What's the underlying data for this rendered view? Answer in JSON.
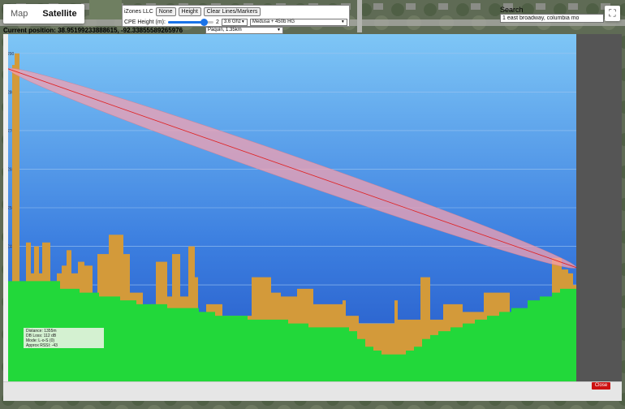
{
  "map_toggle": {
    "map": "Map",
    "satellite": "Satellite"
  },
  "controls": {
    "org": "iZones LLC",
    "none": "None",
    "height": "Height",
    "clear": "Clear Lines/Markers",
    "cpe_label": "CPE Height (m):",
    "cpe_value": "2",
    "cpe_fraction": 0.8,
    "frequency": "3.6 Ghz",
    "antenna": "Medusa + 450b HG"
  },
  "search": {
    "label": "Search",
    "value": "1 east broadway, columbia mo"
  },
  "position": "Current position: 38.95199233888615, -92.33855589265976",
  "link_select": "Paquin, 1.35km",
  "info": {
    "distance": "Distance: 1355m",
    "db_loss": "DB Loss: 112 dB",
    "mode": "Mode: L-o-S (0)",
    "rssi": "Approx RSSI: -43"
  },
  "close": "Close",
  "chart_data": {
    "type": "area",
    "ylim": [
      205,
      295
    ],
    "y_ticks": [
      210,
      220,
      230,
      240,
      250,
      260,
      270,
      280,
      290
    ],
    "x_max": 700,
    "link": {
      "start": 286,
      "end": 234.5
    },
    "terrain": [
      [
        0,
        231
      ],
      [
        40,
        231
      ],
      [
        64,
        229
      ],
      [
        88,
        228
      ],
      [
        112,
        227
      ],
      [
        138,
        226
      ],
      [
        158,
        225
      ],
      [
        196,
        224
      ],
      [
        216,
        224
      ],
      [
        235,
        223
      ],
      [
        255,
        222
      ],
      [
        275,
        222
      ],
      [
        295,
        221
      ],
      [
        320,
        221
      ],
      [
        345,
        220
      ],
      [
        370,
        219
      ],
      [
        400,
        219
      ],
      [
        420,
        218
      ],
      [
        430,
        216
      ],
      [
        440,
        214
      ],
      [
        450,
        213
      ],
      [
        460,
        212
      ],
      [
        470,
        212
      ],
      [
        480,
        212
      ],
      [
        490,
        213
      ],
      [
        500,
        214
      ],
      [
        510,
        216
      ],
      [
        520,
        217
      ],
      [
        530,
        218
      ],
      [
        545,
        219
      ],
      [
        560,
        220
      ],
      [
        575,
        221
      ],
      [
        590,
        222
      ],
      [
        605,
        223
      ],
      [
        620,
        224
      ],
      [
        640,
        226
      ],
      [
        655,
        227
      ],
      [
        670,
        228
      ],
      [
        680,
        229
      ],
      [
        700,
        230
      ]
    ],
    "clutter": [
      [
        5,
        287
      ],
      [
        8,
        290
      ],
      [
        14,
        226
      ],
      [
        22,
        241
      ],
      [
        28,
        233
      ],
      [
        32,
        240
      ],
      [
        38,
        233
      ],
      [
        42,
        241
      ],
      [
        52,
        231
      ],
      [
        60,
        233
      ],
      [
        66,
        235
      ],
      [
        72,
        239
      ],
      [
        78,
        233
      ],
      [
        86,
        236
      ],
      [
        94,
        235
      ],
      [
        104,
        227
      ],
      [
        110,
        238
      ],
      [
        116,
        238
      ],
      [
        124,
        243
      ],
      [
        132,
        243
      ],
      [
        142,
        238
      ],
      [
        150,
        228
      ],
      [
        166,
        222
      ],
      [
        176,
        225
      ],
      [
        182,
        236
      ],
      [
        196,
        227
      ],
      [
        202,
        238
      ],
      [
        212,
        227
      ],
      [
        222,
        240
      ],
      [
        230,
        232
      ],
      [
        234,
        222
      ],
      [
        244,
        225
      ],
      [
        250,
        225
      ],
      [
        264,
        222
      ],
      [
        300,
        232
      ],
      [
        310,
        232
      ],
      [
        324,
        228
      ],
      [
        336,
        227
      ],
      [
        356,
        229
      ],
      [
        376,
        225
      ],
      [
        412,
        226
      ],
      [
        416,
        222
      ],
      [
        432,
        220
      ],
      [
        476,
        226
      ],
      [
        480,
        221
      ],
      [
        508,
        232
      ],
      [
        520,
        221
      ],
      [
        536,
        225
      ],
      [
        560,
        223
      ],
      [
        586,
        228
      ],
      [
        618,
        222
      ],
      [
        670,
        237
      ],
      [
        682,
        234
      ],
      [
        690,
        233
      ],
      [
        696,
        230
      ],
      [
        700,
        235
      ]
    ]
  }
}
